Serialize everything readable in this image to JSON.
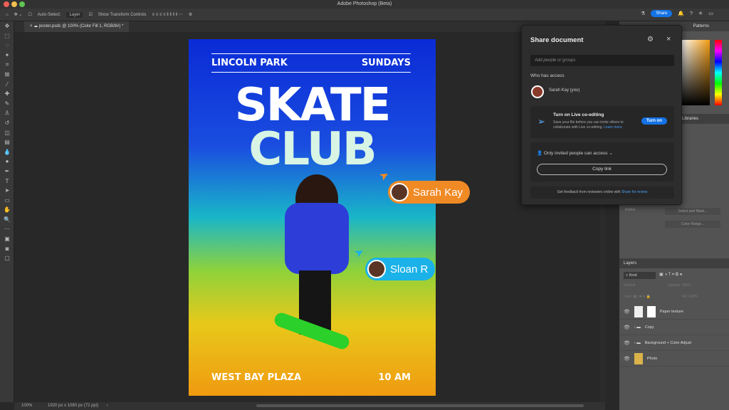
{
  "app": {
    "title": "Adobe Photoshop (Beta)",
    "share_label": "Share"
  },
  "options": {
    "auto_select_label": "Auto-Select:",
    "auto_select_value": "Layer",
    "transform_label": "Show Transform Controls"
  },
  "tab": {
    "label": "poster.psdc @ 100% (Color Fill 1, RGB/8#) *"
  },
  "poster": {
    "top_left": "LINCOLN PARK",
    "top_right": "SUNDAYS",
    "title1": "SKATE",
    "title2": "CLUB",
    "bottom_left": "WEST BAY PLAZA",
    "bottom_right": "10 AM"
  },
  "cursors": [
    {
      "name": "Sarah Kay",
      "color": "#f08a24"
    },
    {
      "name": "Sloan R",
      "color": "#1ab2e8"
    }
  ],
  "share": {
    "title": "Share document",
    "input_placeholder": "Add people or groups",
    "access_heading": "Who has access",
    "user": "Sarah Kay (you)",
    "coedit_title": "Turn on Live co-editing",
    "coedit_desc": "Save your file before you can invite others to collaborate with Live co-editing.",
    "learn_more": "Learn more",
    "turn_on": "Turn on",
    "access_mode": "Only invited people can access",
    "copy_link": "Copy link",
    "feedback": "Get feedback from reviewers online with",
    "feedback_link": "Share for review"
  },
  "panels": {
    "tabs_top": [
      "Patterns"
    ],
    "libraries": "Libraries",
    "refine": "Refine",
    "select_mask": "Select and Mask...",
    "color_range": "Color Range...",
    "layers_title": "Layers",
    "kind": "Kind",
    "blend": "Normal",
    "opacity_label": "Opacity:",
    "opacity": "100%",
    "lock_label": "Lock:",
    "fill_label": "Fill:",
    "fill": "100%",
    "layers": [
      {
        "name": "Paper texture",
        "type": "smart"
      },
      {
        "name": "Copy",
        "type": "group"
      },
      {
        "name": "Background + Color Adjust",
        "type": "group"
      },
      {
        "name": "Photo",
        "type": "image"
      }
    ]
  },
  "status": {
    "zoom": "100%",
    "doc_info": "1920 px x 1080 px (72 ppi)"
  }
}
